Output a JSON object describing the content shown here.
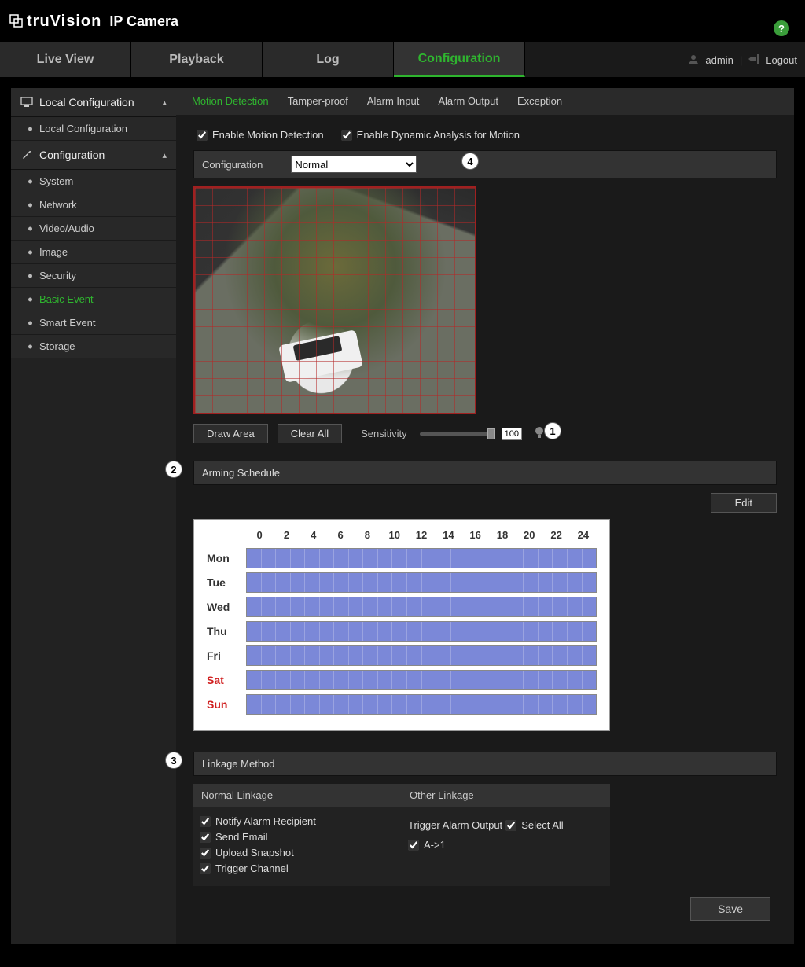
{
  "brand": {
    "name": "truVision",
    "product": "IP Camera"
  },
  "nav": {
    "tabs": [
      "Live View",
      "Playback",
      "Log",
      "Configuration"
    ],
    "active": 3,
    "user": "admin",
    "logout": "Logout"
  },
  "sidebar": {
    "groups": [
      {
        "label": "Local Configuration",
        "items": [
          "Local Configuration"
        ]
      },
      {
        "label": "Configuration",
        "items": [
          "System",
          "Network",
          "Video/Audio",
          "Image",
          "Security",
          "Basic Event",
          "Smart Event",
          "Storage"
        ],
        "active": 5
      }
    ]
  },
  "subtabs": {
    "items": [
      "Motion Detection",
      "Tamper-proof",
      "Alarm Input",
      "Alarm Output",
      "Exception"
    ],
    "active": 0
  },
  "motion": {
    "enable_label": "Enable Motion Detection",
    "enable_checked": true,
    "dynamic_label": "Enable Dynamic Analysis for Motion",
    "dynamic_checked": true,
    "config_label": "Configuration",
    "config_value": "Normal",
    "draw_btn": "Draw Area",
    "clear_btn": "Clear All",
    "sensitivity_label": "Sensitivity",
    "sensitivity_value": "100"
  },
  "callouts": {
    "area": "1",
    "schedule": "2",
    "linkage": "3",
    "config": "4"
  },
  "schedule": {
    "title": "Arming Schedule",
    "edit": "Edit",
    "hours": [
      "0",
      "2",
      "4",
      "6",
      "8",
      "10",
      "12",
      "14",
      "16",
      "18",
      "20",
      "22",
      "24"
    ],
    "days": [
      "Mon",
      "Tue",
      "Wed",
      "Thu",
      "Fri",
      "Sat",
      "Sun"
    ]
  },
  "linkage": {
    "title": "Linkage Method",
    "normal_label": "Normal Linkage",
    "other_label": "Other Linkage",
    "normal": [
      {
        "label": "Notify Alarm Recipient",
        "checked": true
      },
      {
        "label": "Send Email",
        "checked": true
      },
      {
        "label": "Upload Snapshot",
        "checked": true
      },
      {
        "label": "Trigger Channel",
        "checked": true
      }
    ],
    "other": {
      "trigger_label": "Trigger Alarm Output",
      "select_all_label": "Select All",
      "select_all_checked": true,
      "outputs": [
        {
          "label": "A->1",
          "checked": true
        }
      ]
    }
  },
  "save_label": "Save"
}
